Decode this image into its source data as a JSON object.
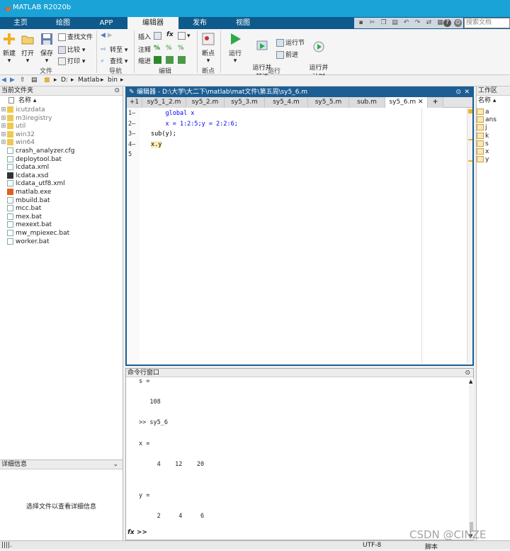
{
  "app": {
    "title": "MATLAB R2020b"
  },
  "ribbon_tabs": [
    "主页",
    "绘图",
    "APP",
    "编辑器",
    "发布",
    "视图"
  ],
  "search": {
    "placeholder": "搜索文档"
  },
  "ribbon": {
    "file": {
      "new": "新建",
      "open": "打开",
      "save": "保存",
      "find_files": "查找文件",
      "compare": "比较",
      "print": "打印",
      "group": "文件"
    },
    "nav": {
      "goto": "转至",
      "find": "查找",
      "group": "导航"
    },
    "edit": {
      "insert": "插入",
      "comment": "注释",
      "indent": "缩进",
      "fx": "fx",
      "group": "编辑"
    },
    "breakpoints": {
      "label": "断点",
      "group": "断点"
    },
    "run": {
      "run": "运行",
      "run_advance": "运行并\n前进",
      "run_section": "运行节",
      "advance": "前进",
      "run_time": "运行并\n计时",
      "group": "运行"
    }
  },
  "address": {
    "drive": "D:",
    "folder1": "Matlab",
    "folder2": "bin"
  },
  "current_folder": {
    "title": "当前文件夹",
    "col_name": "名称",
    "items": [
      {
        "name": "icutzdata",
        "type": "folder"
      },
      {
        "name": "m3iregistry",
        "type": "folder"
      },
      {
        "name": "util",
        "type": "folder"
      },
      {
        "name": "win32",
        "type": "folder"
      },
      {
        "name": "win64",
        "type": "folder"
      },
      {
        "name": "crash_analyzer.cfg",
        "type": "file"
      },
      {
        "name": "deploytool.bat",
        "type": "file"
      },
      {
        "name": "lcdata.xml",
        "type": "file"
      },
      {
        "name": "lcdata.xsd",
        "type": "xsd"
      },
      {
        "name": "lcdata_utf8.xml",
        "type": "file"
      },
      {
        "name": "matlab.exe",
        "type": "exe"
      },
      {
        "name": "mbuild.bat",
        "type": "file"
      },
      {
        "name": "mcc.bat",
        "type": "file"
      },
      {
        "name": "mex.bat",
        "type": "file"
      },
      {
        "name": "mexext.bat",
        "type": "file"
      },
      {
        "name": "mw_mpiexec.bat",
        "type": "file"
      },
      {
        "name": "worker.bat",
        "type": "file"
      }
    ]
  },
  "details": {
    "title": "详细信息",
    "message": "选择文件以查看详细信息"
  },
  "editor": {
    "title": "编辑器 - D:\\大学\\大二下\\matlab\\mat文件\\第五周\\sy5_6.m",
    "tabs": [
      "sy5_1_2.m",
      "sy5_2.m",
      "sy5_3.m",
      "sy5_4.m",
      "sy5_5.m",
      "sub.m",
      "sy5_6.m"
    ],
    "add_tab": "+",
    "lines": [
      {
        "num": "1",
        "code": "    global x"
      },
      {
        "num": "2",
        "code": "    x = 1:2:5;y = 2:2:6;"
      },
      {
        "num": "3",
        "code": "sub(y);"
      },
      {
        "num": "4",
        "code": "x.y"
      },
      {
        "num": "5",
        "code": ""
      }
    ]
  },
  "command_window": {
    "title": "命令行窗口",
    "lines": [
      "s =",
      "",
      "   108",
      "",
      ">> sy5_6",
      "",
      "x =",
      "",
      "     4    12    20",
      "",
      "",
      "y =",
      "",
      "     2     4     6"
    ],
    "prompt": "fx >>"
  },
  "workspace": {
    "title": "工作区",
    "col_name": "名称",
    "vars": [
      "a",
      "ans",
      "j",
      "k",
      "s",
      "x",
      "y"
    ]
  },
  "status": {
    "encoding": "UTF-8",
    "mode": "脚本"
  },
  "watermark": "CSDN @CINZE"
}
